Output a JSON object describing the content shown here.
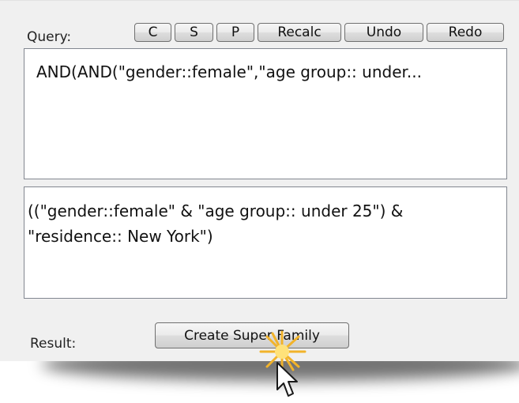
{
  "query_panel": {
    "query_label": "Query:",
    "buttons": {
      "c": "C",
      "s": "S",
      "p": "P",
      "recalc": "Recalc",
      "undo": "Undo",
      "redo": "Redo"
    },
    "query_text": "AND(AND(\"gender::female\",\"age group:: under...",
    "expression_text": "((\"gender::female\" & \"age group:: under 25\") &\n\"residence:: New York\")"
  },
  "result_row": {
    "result_label": "Result:",
    "create_button_label": "Create Super Family"
  },
  "colors": {
    "panel_background": "#f0f0f0",
    "field_border": "#828790",
    "click_burst": "#f2b32a"
  },
  "icons": {
    "click_indicator": "click-burst-icon",
    "pointer": "mouse-pointer-icon"
  }
}
